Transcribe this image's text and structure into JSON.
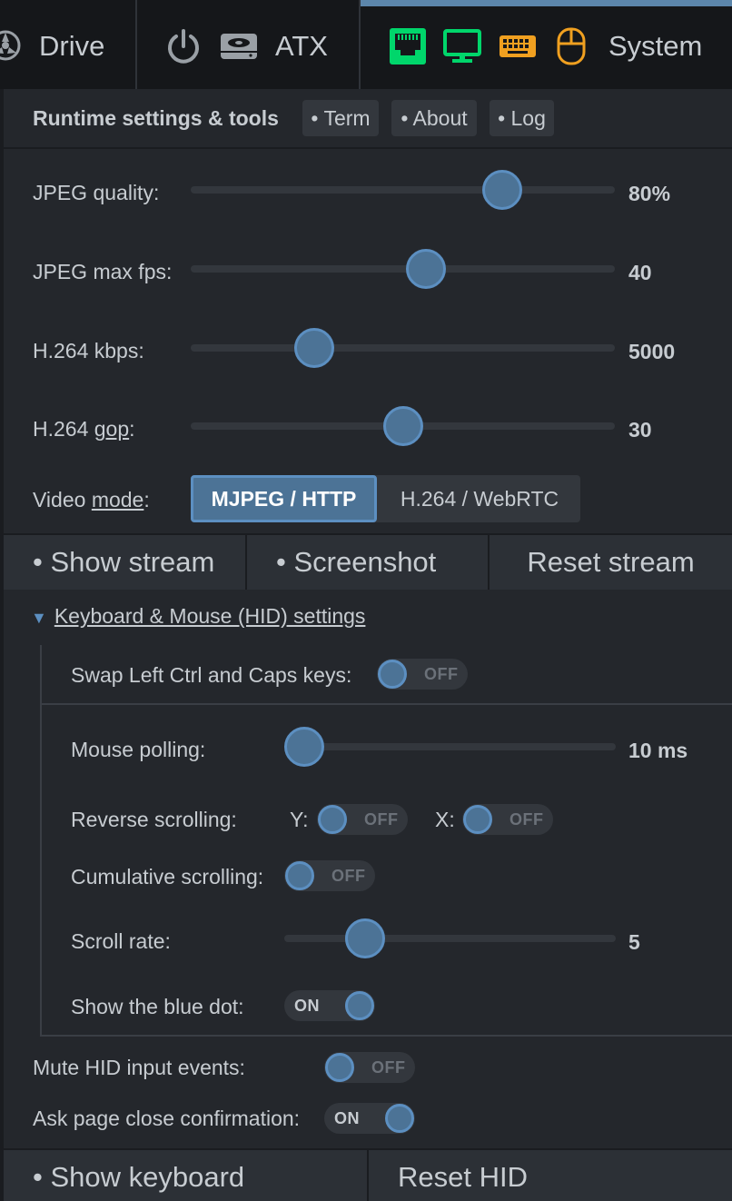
{
  "navbar": {
    "drive_label": "Drive",
    "atx_label": "ATX",
    "system_label": "System",
    "icons": {
      "drive": "disc-icon",
      "power": "power-icon",
      "atx": "hard-drive-icon",
      "network": "network-port-icon",
      "screen": "monitor-icon",
      "keyboard": "keyboard-icon",
      "mouse": "mouse-icon"
    },
    "colors": {
      "ok": "#00d66b",
      "warn": "#f0a020",
      "accent": "#5c86ab"
    }
  },
  "header": {
    "title": "Runtime settings & tools",
    "term_label": "• Term",
    "about_label": "• About",
    "log_label": "• Log"
  },
  "stream": {
    "jpeg_quality": {
      "label": "JPEG quality:",
      "value": "80%",
      "level": 0.76
    },
    "jpeg_fps": {
      "label": "JPEG max fps:",
      "value": "40",
      "level": 0.56
    },
    "h264_kbps": {
      "label": "H.264 kbps:",
      "value": "5000",
      "level": 0.27
    },
    "h264_gop": {
      "label_prefix": "H.264 ",
      "label_underlined": "gop",
      "label_suffix": ":",
      "value": "30",
      "level": 0.5
    },
    "video_mode": {
      "label_prefix": "Video ",
      "label_underlined": "mode",
      "label_suffix": ":",
      "options": [
        "MJPEG / HTTP",
        "H.264 / WebRTC"
      ],
      "selected": "MJPEG / HTTP"
    },
    "buttons": {
      "show_stream": "• Show stream",
      "screenshot": "• Screenshot",
      "reset_stream": "Reset stream"
    }
  },
  "hid": {
    "spoiler_marker": "▼",
    "spoiler_label": "Keyboard & Mouse (HID) settings",
    "swap_ctrl_caps": {
      "label": "Swap Left Ctrl and Caps keys:",
      "state": "OFF"
    },
    "mouse_polling": {
      "label": "Mouse polling:",
      "value": "10 ms",
      "level": 0.0
    },
    "reverse_scrolling": {
      "label": "Reverse scrolling:",
      "y_label": "Y:",
      "y_state": "OFF",
      "x_label": "X:",
      "x_state": "OFF"
    },
    "cumulative_scrolling": {
      "label": "Cumulative scrolling:",
      "state": "OFF"
    },
    "scroll_rate": {
      "label": "Scroll rate:",
      "value": "5",
      "level": 0.21
    },
    "blue_dot": {
      "label": "Show the blue dot:",
      "state": "ON"
    },
    "mute_events": {
      "label": "Mute HID input events:",
      "state": "OFF"
    },
    "page_close": {
      "label": "Ask page close confirmation:",
      "state": "ON"
    },
    "buttons": {
      "show_keyboard": "• Show keyboard",
      "reset_hid": "Reset HID"
    }
  }
}
